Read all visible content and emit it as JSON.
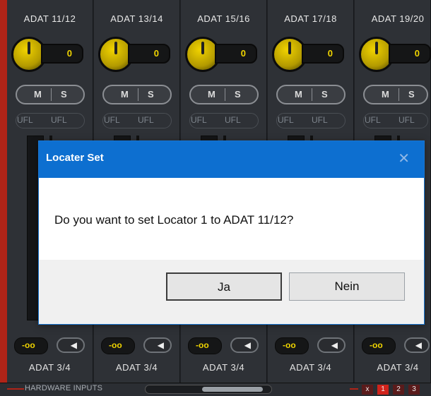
{
  "mixer": {
    "channels": [
      {
        "title": "ADAT 11/12",
        "gain": "0",
        "m": "M",
        "s": "S",
        "ufl_left": "UFL",
        "ufl_right": "UFL",
        "pan": "-oo",
        "pan_icon": "◀",
        "route": "ADAT 3/4"
      },
      {
        "title": "ADAT 13/14",
        "gain": "0",
        "m": "M",
        "s": "S",
        "ufl_left": "UFL",
        "ufl_right": "UFL",
        "pan": "-oo",
        "pan_icon": "◀",
        "route": "ADAT 3/4"
      },
      {
        "title": "ADAT 15/16",
        "gain": "0",
        "m": "M",
        "s": "S",
        "ufl_left": "UFL",
        "ufl_right": "UFL",
        "pan": "-oo",
        "pan_icon": "◀",
        "route": "ADAT 3/4"
      },
      {
        "title": "ADAT 17/18",
        "gain": "0",
        "m": "M",
        "s": "S",
        "ufl_left": "UFL",
        "ufl_right": "UFL",
        "pan": "-oo",
        "pan_icon": "◀",
        "route": "ADAT 3/4"
      },
      {
        "title": "ADAT 19/20",
        "gain": "0",
        "m": "M",
        "s": "S",
        "ufl_left": "UFL",
        "ufl_right": "UFL",
        "pan": "-oo",
        "pan_icon": "◀",
        "route": "ADAT 3/4"
      }
    ],
    "footer": {
      "label": "HARDWARE INPUTS",
      "indicators": [
        "x",
        "1",
        "2",
        "3"
      ]
    },
    "colors": {
      "accent": "#f0d400",
      "record": "#d0231b",
      "panel": "#2e3136"
    }
  },
  "dialog": {
    "title": "Locater Set",
    "close_icon": "✕",
    "message": "Do you want to set Locator 1 to ADAT 11/12?",
    "yes_label": "Ja",
    "no_label": "Nein"
  }
}
